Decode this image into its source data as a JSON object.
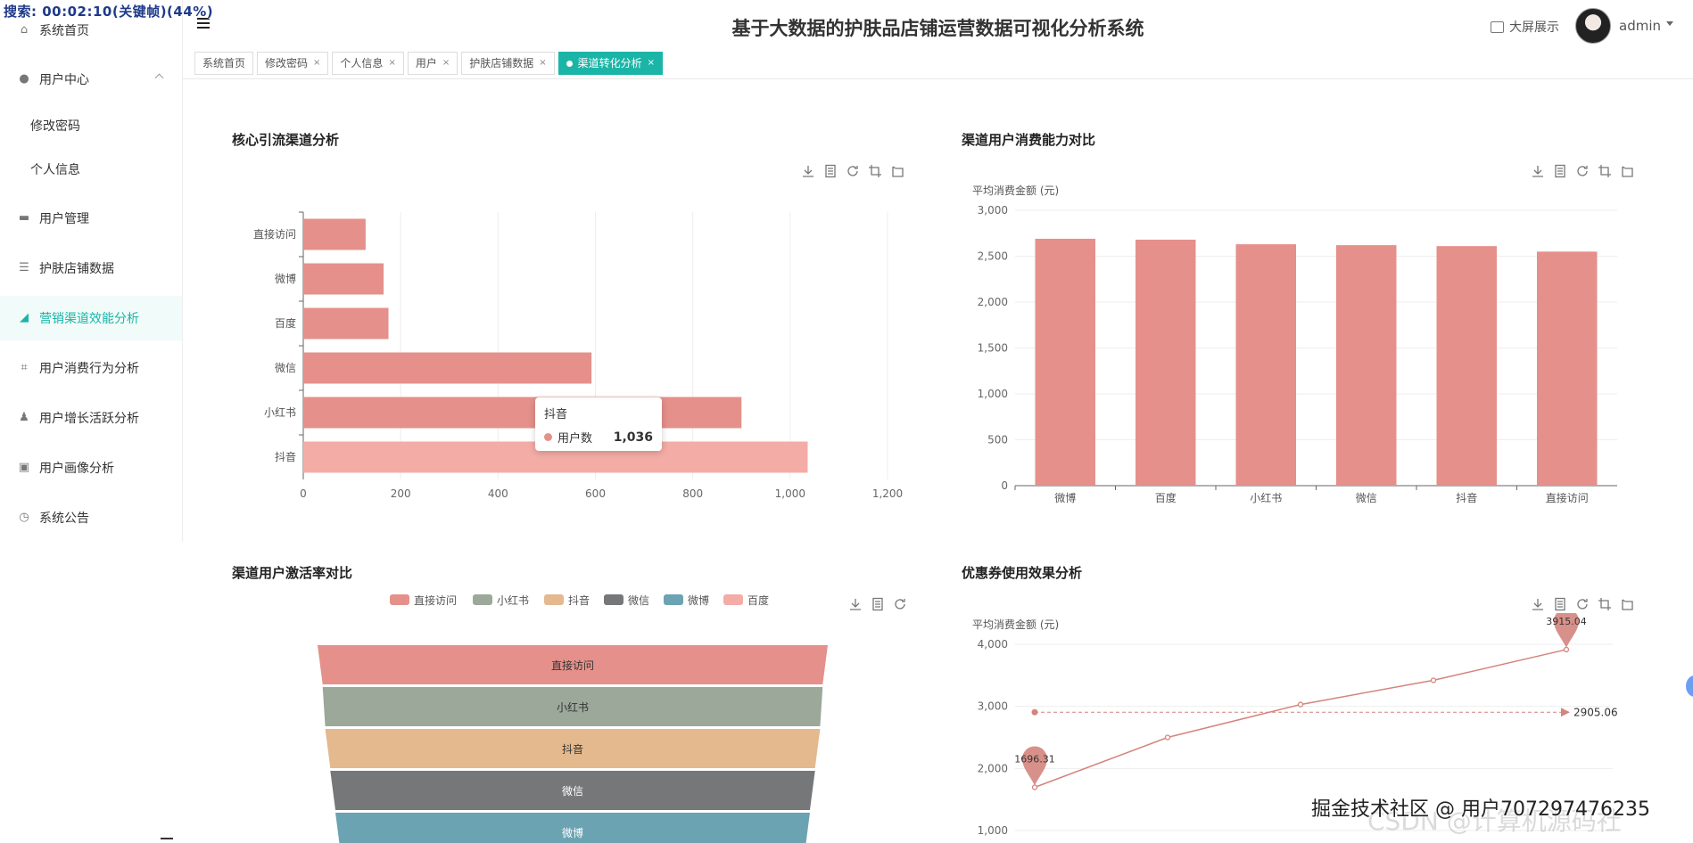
{
  "overlay": "搜索: 00:02:10(关键帧)(44%)",
  "header": {
    "title": "基于大数据的护肤品店铺运营数据可视化分析系统",
    "screen_label": "大屏展示",
    "user": "admin"
  },
  "tabs": [
    {
      "label": "系统首页",
      "closable": false
    },
    {
      "label": "修改密码",
      "closable": true
    },
    {
      "label": "个人信息",
      "closable": true
    },
    {
      "label": "用户",
      "closable": true
    },
    {
      "label": "护肤店铺数据",
      "closable": true
    },
    {
      "label": "渠道转化分析",
      "closable": true,
      "active": true
    }
  ],
  "sidebar": {
    "items": [
      {
        "label": "系统首页",
        "icon": "home-icon"
      },
      {
        "label": "用户中心",
        "icon": "user-icon"
      },
      {
        "label": "修改密码",
        "icon": ""
      },
      {
        "label": "个人信息",
        "icon": ""
      },
      {
        "label": "用户管理",
        "icon": "monitor-icon"
      },
      {
        "label": "护肤店铺数据",
        "icon": "list-icon"
      },
      {
        "label": "营销渠道效能分析",
        "icon": "trend-icon"
      },
      {
        "label": "用户消费行为分析",
        "icon": "crop-icon"
      },
      {
        "label": "用户增长活跃分析",
        "icon": "person-icon"
      },
      {
        "label": "用户画像分析",
        "icon": "chat-icon"
      },
      {
        "label": "系统公告",
        "icon": "clock-icon"
      }
    ]
  },
  "panels": {
    "p1": {
      "title": "核心引流渠道分析"
    },
    "p2": {
      "title": "渠道用户消费能力对比"
    },
    "p3": {
      "title": "渠道用户激活率对比"
    },
    "p4": {
      "title": "优惠券使用效果分析"
    }
  },
  "tooltip": {
    "title": "抖音",
    "series": "用户数",
    "value": "1,036"
  },
  "watermark": "掘金技术社区 @ 用户707297476235",
  "csdn": "CSDN @计算机源码社",
  "chart_data": [
    {
      "type": "bar",
      "orientation": "horizontal",
      "categories": [
        "直接访问",
        "微博",
        "百度",
        "微信",
        "小红书",
        "抖音"
      ],
      "values": [
        128,
        165,
        175,
        592,
        900,
        1036
      ],
      "xlim": [
        0,
        1200
      ],
      "xticks": [
        "0",
        "200",
        "400",
        "600",
        "800",
        "1,000",
        "1,200"
      ],
      "highlight": "抖音",
      "color": "#e5908a",
      "highlight_color": "#f4aca6"
    },
    {
      "type": "bar",
      "categories": [
        "微博",
        "百度",
        "小红书",
        "微信",
        "抖音",
        "直接访问"
      ],
      "values": [
        2690,
        2680,
        2630,
        2620,
        2610,
        2550
      ],
      "ylabel": "平均消费金额 (元)",
      "ylim": [
        0,
        3000
      ],
      "yticks": [
        "0",
        "500",
        "1,000",
        "1,500",
        "2,000",
        "2,500",
        "3,000"
      ],
      "color": "#e5908a"
    },
    {
      "type": "funnel",
      "legend": [
        "直接访问",
        "小红书",
        "抖音",
        "微信",
        "微博",
        "百度"
      ],
      "legend_colors": [
        "#e5908a",
        "#9ba89a",
        "#e4b98d",
        "#767779",
        "#6ba3b2",
        "#f4aca6"
      ],
      "stages": [
        "直接访问",
        "小红书",
        "抖音",
        "微信",
        "微博"
      ],
      "values": [
        100,
        98,
        97,
        95,
        93
      ]
    },
    {
      "type": "line",
      "ylabel": "平均消费金额 (元)",
      "ylim": [
        1000,
        4000
      ],
      "yticks": [
        "1,000",
        "2,000",
        "3,000",
        "4,000"
      ],
      "values": [
        1696.31,
        2500,
        3030,
        3420,
        3915.04
      ],
      "max_label": "3915.04",
      "min_label": "1696.31",
      "mean": 2905.06,
      "mean_label": "2905.06",
      "color": "#d4847d"
    }
  ]
}
